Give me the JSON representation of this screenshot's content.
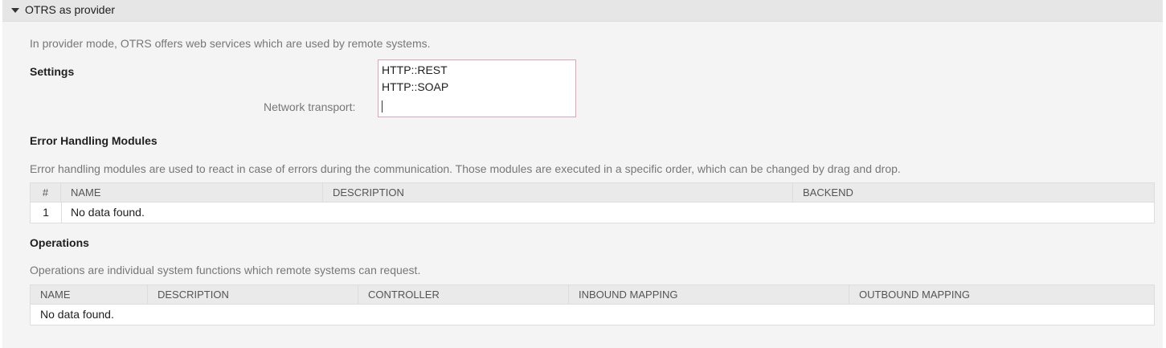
{
  "provider_widget": {
    "title": "OTRS as provider",
    "description": "In provider mode, OTRS offers web services which are used by remote systems."
  },
  "settings": {
    "heading": "Settings",
    "network_transport_label": "Network transport:",
    "network_transport_options": [
      "HTTP::REST",
      "HTTP::SOAP"
    ]
  },
  "error_handling": {
    "heading": "Error Handling Modules",
    "description": "Error handling modules are used to react in case of errors during the communication. Those modules are executed in a specific order, which can be changed by drag and drop.",
    "columns": [
      "#",
      "NAME",
      "DESCRIPTION",
      "BACKEND"
    ],
    "rows": [
      {
        "index": "1",
        "message": "No data found."
      }
    ]
  },
  "operations": {
    "heading": "Operations",
    "description": "Operations are individual system functions which remote systems can request.",
    "columns": [
      "NAME",
      "DESCRIPTION",
      "CONTROLLER",
      "INBOUND MAPPING",
      "OUTBOUND MAPPING"
    ],
    "rows": [
      {
        "message": "No data found."
      }
    ]
  },
  "icons": {
    "toggle": "triangle-down-icon"
  },
  "colors": {
    "panel_background": "#f4f4f4",
    "header_background": "#e6e6e6",
    "table_header_background": "#eaeaea",
    "invalid_field_border": "#e0a4b8",
    "muted_text": "#777777"
  }
}
